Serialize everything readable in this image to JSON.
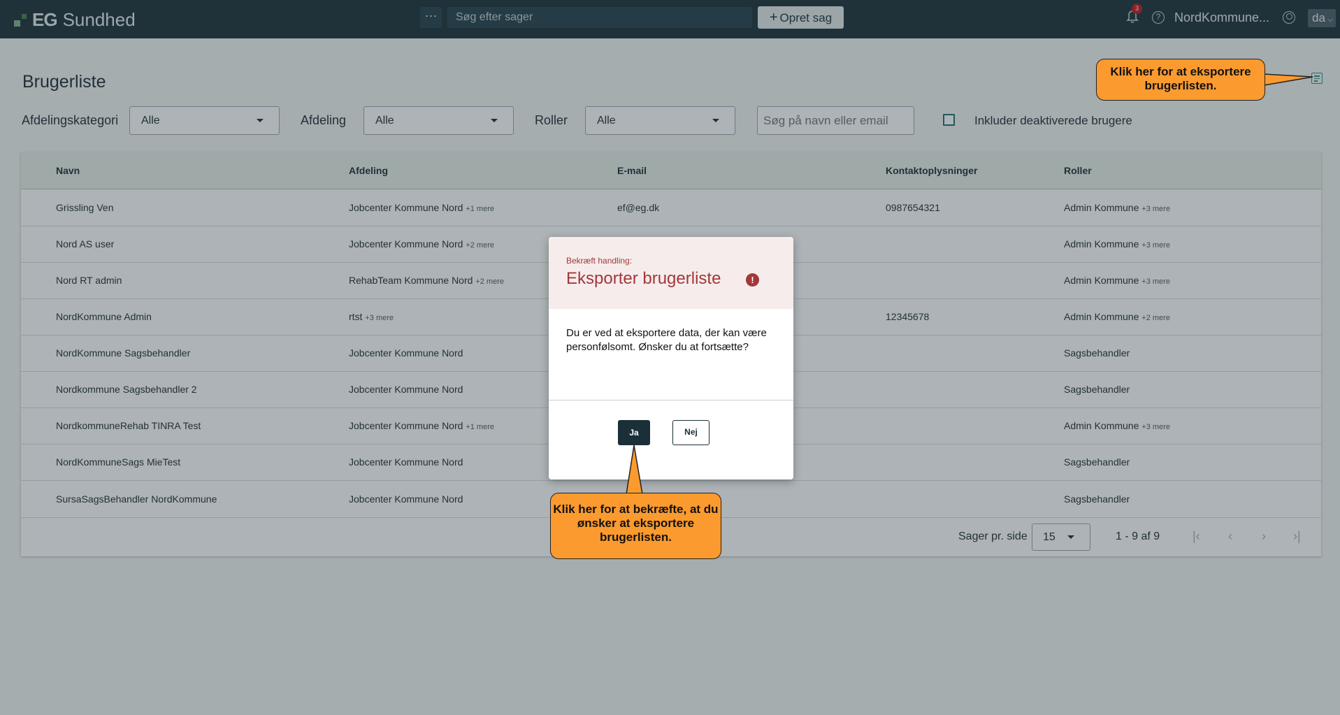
{
  "topbar": {
    "brand_eg": "EG",
    "brand_name": "Sundhed",
    "more_label": "···",
    "search_placeholder": "Søg efter sager",
    "create_label": "Opret sag",
    "notification_count": "3",
    "user_name": "NordKommune...",
    "language": "da"
  },
  "page": {
    "title": "Brugerliste"
  },
  "filters": {
    "category_label": "Afdelingskategori",
    "category_value": "Alle",
    "department_label": "Afdeling",
    "department_value": "Alle",
    "roles_label": "Roller",
    "roles_value": "Alle",
    "search_placeholder": "Søg på navn eller email",
    "include_deactivated_label": "Inkluder deaktiverede brugere"
  },
  "table": {
    "headers": [
      "Navn",
      "Afdeling",
      "E-mail",
      "Kontaktoplysninger",
      "Roller"
    ],
    "rows": [
      {
        "name": "Grissling Ven",
        "dept": "Jobcenter Kommune Nord",
        "dept_more": "+1 mere",
        "email": "ef@eg.dk",
        "contact": "0987654321",
        "role": "Admin Kommune",
        "role_more": "+3 mere"
      },
      {
        "name": "Nord AS user",
        "dept": "Jobcenter Kommune Nord",
        "dept_more": "+2 mere",
        "email": "",
        "contact": "",
        "role": "Admin Kommune",
        "role_more": "+3 mere"
      },
      {
        "name": "Nord RT admin",
        "dept": "RehabTeam Kommune Nord",
        "dept_more": "+2 mere",
        "email": "",
        "contact": "",
        "role": "Admin Kommune",
        "role_more": "+3 mere"
      },
      {
        "name": "NordKommune Admin",
        "dept": "rtst",
        "dept_more": "+3 mere",
        "email": "",
        "contact": "12345678",
        "role": "Admin Kommune",
        "role_more": "+2 mere"
      },
      {
        "name": "NordKommune Sagsbehandler",
        "dept": "Jobcenter Kommune Nord",
        "dept_more": "",
        "email": "",
        "contact": "",
        "role": "Sagsbehandler",
        "role_more": ""
      },
      {
        "name": "Nordkommune Sagsbehandler 2",
        "dept": "Jobcenter Kommune Nord",
        "dept_more": "",
        "email": "",
        "contact": "",
        "role": "Sagsbehandler",
        "role_more": ""
      },
      {
        "name": "NordkommuneRehab TINRA Test",
        "dept": "Jobcenter Kommune Nord",
        "dept_more": "+1 mere",
        "email": "",
        "contact": "",
        "role": "Admin Kommune",
        "role_more": "+3 mere"
      },
      {
        "name": "NordKommuneSags MieTest",
        "dept": "Jobcenter Kommune Nord",
        "dept_more": "",
        "email": "",
        "contact": "",
        "role": "Sagsbehandler",
        "role_more": ""
      },
      {
        "name": "SursaSagsBehandler NordKommune",
        "dept": "Jobcenter Kommune Nord",
        "dept_more": "",
        "email": "",
        "contact": "",
        "role": "Sagsbehandler",
        "role_more": ""
      }
    ]
  },
  "pager": {
    "per_page_label": "Sager pr. side",
    "per_page_value": "15",
    "range": "1 - 9 af 9"
  },
  "dialog": {
    "subtitle": "Bekræft handling:",
    "title": "Eksporter brugerliste",
    "warning_glyph": "!",
    "body": "Du er ved at eksportere data, der kan være personfølsomt. Ønsker du at fortsætte?",
    "yes_label": "Ja",
    "no_label": "Nej"
  },
  "callouts": {
    "export_hint": "Klik her for at eksportere brugerlisten.",
    "confirm_hint": "Klik her for at bekræfte, at du ønsker at eksportere brugerlisten."
  },
  "colors": {
    "topbar": "#1b2f38",
    "accent": "#2d8f8a",
    "dialog_title": "#a2383a",
    "callout": "#fb9a2e"
  }
}
